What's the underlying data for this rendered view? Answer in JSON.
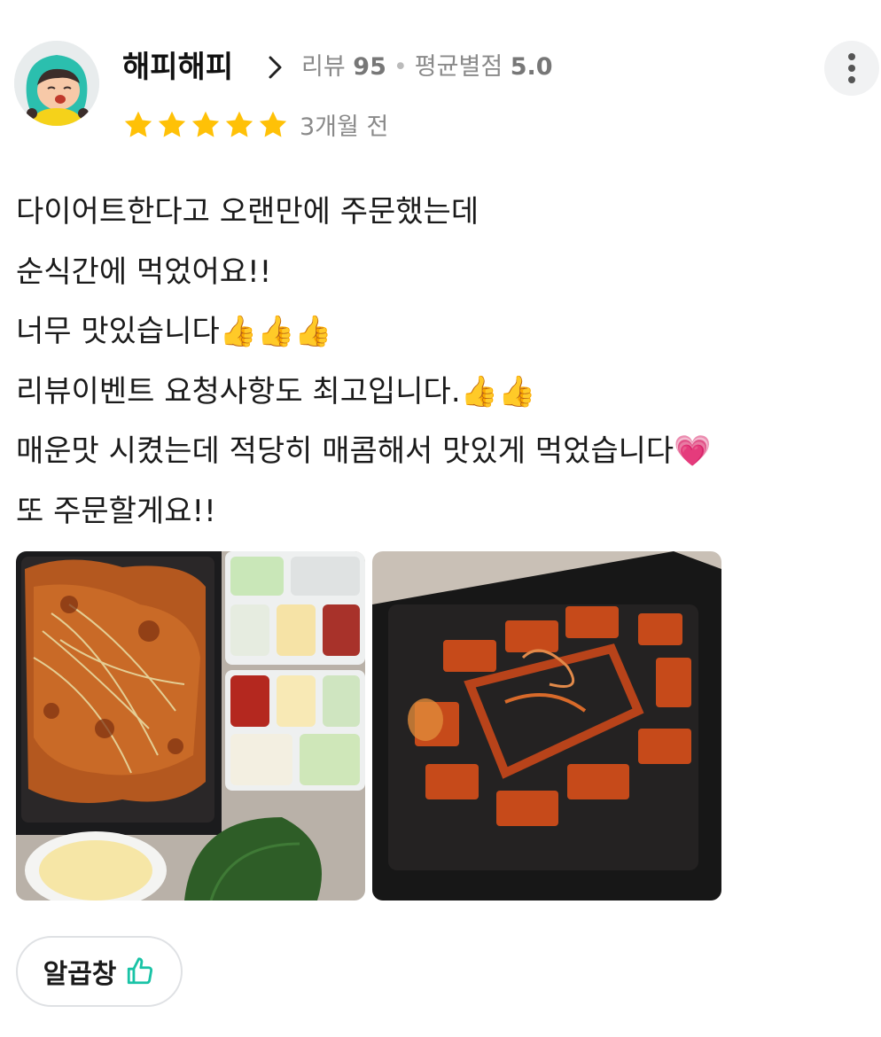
{
  "reviewer": {
    "nickname": "해피해피",
    "review_count_label": "리뷰",
    "review_count": "95",
    "avg_rating_label": "평균별점",
    "avg_rating": "5.0"
  },
  "review": {
    "rating": 5,
    "time_ago": "3개월 전",
    "lines": [
      "다이어트한다고 오랜만에 주문했는데",
      "순식간에 먹었어요!!",
      "너무 맛있습니다👍👍👍",
      "리뷰이벤트 요청사항도 최고입니다.👍👍",
      "매운맛 시켰는데 적당히 매콤해서 맛있게 먹었습니다💗",
      "또 주문할게요!!"
    ],
    "tag_label": "알곱창"
  },
  "icons": {
    "chevron": "chevron-right-icon",
    "more": "more-vertical-icon",
    "star": "star-icon",
    "thumb": "thumbs-up-icon"
  },
  "colors": {
    "star": "#FFC107",
    "tag_icon": "#19C3A6",
    "meta_text": "#8A8A8A"
  }
}
